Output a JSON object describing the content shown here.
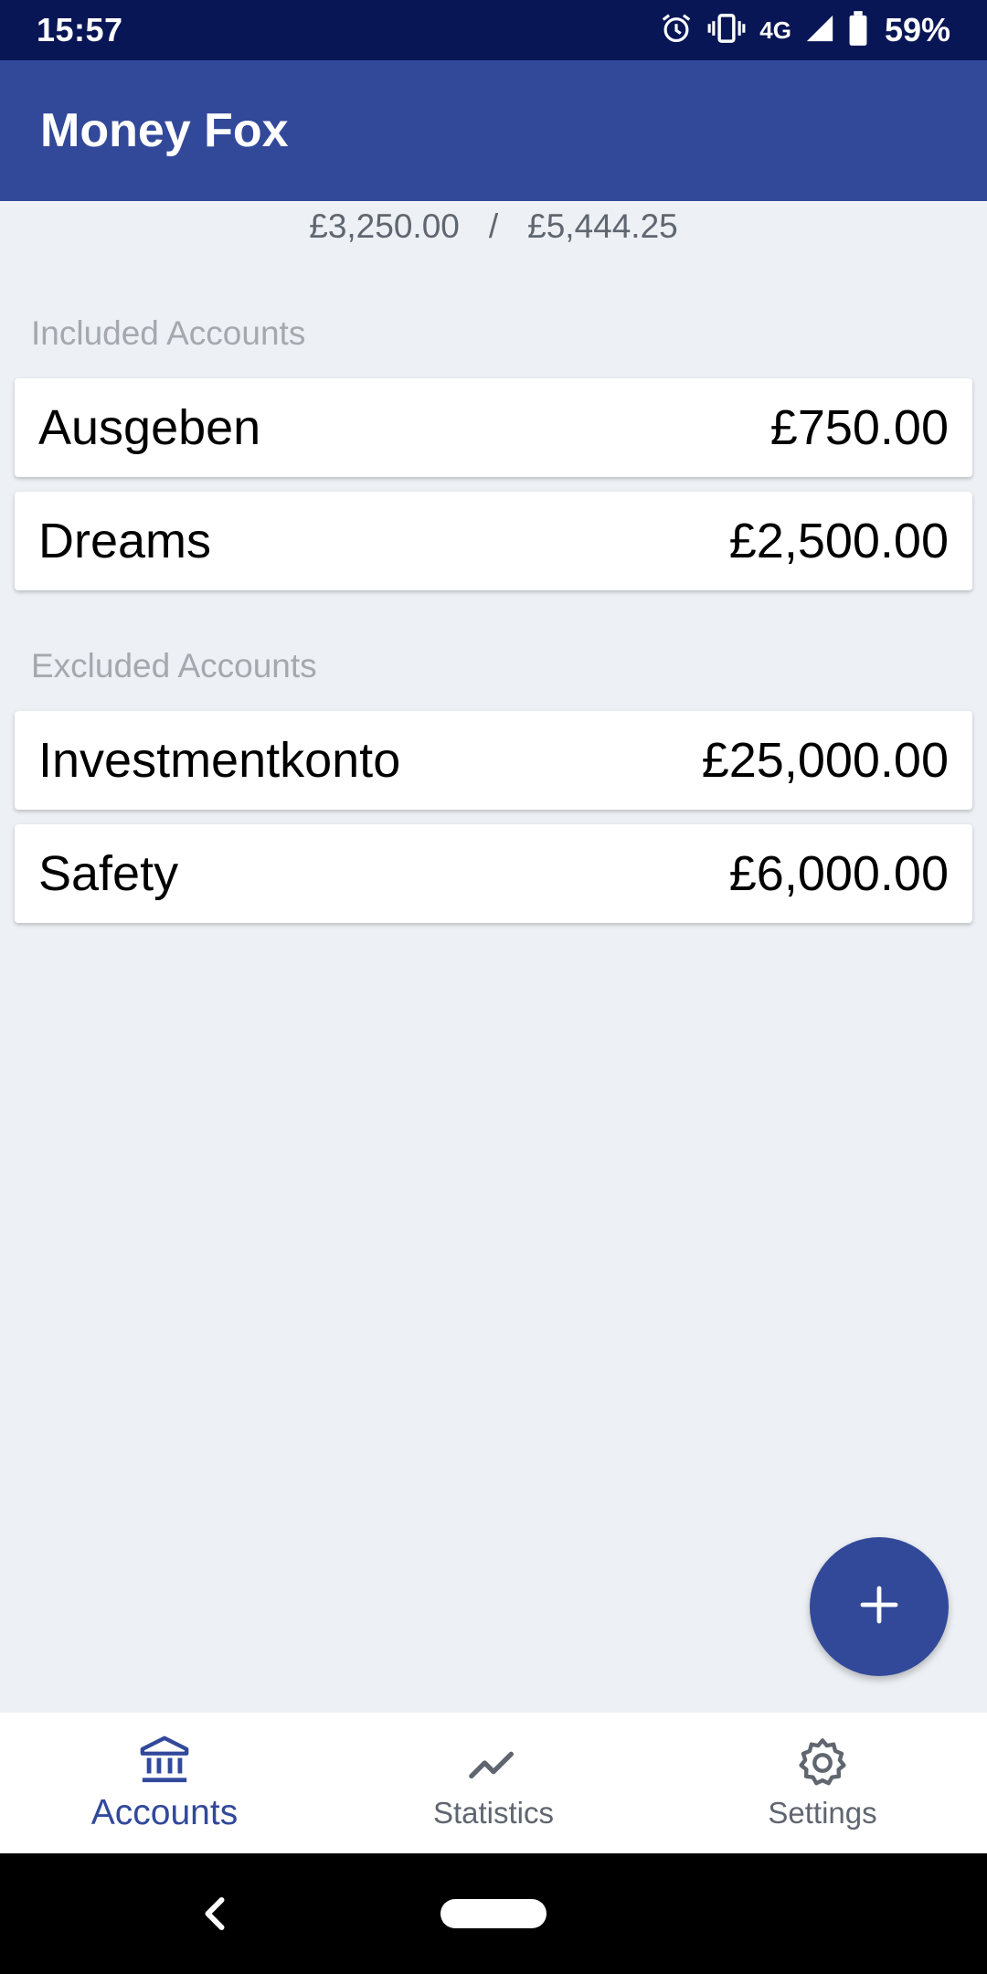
{
  "status_bar": {
    "time": "15:57",
    "network": "4G",
    "battery": "59%",
    "icons": [
      "alarm-icon",
      "vibrate-icon",
      "signal-icon",
      "battery-icon"
    ]
  },
  "app_bar": {
    "title": "Money Fox"
  },
  "summary": {
    "included_balance": "£3,250.00",
    "separator": "/",
    "total_balance": "£5,444.25"
  },
  "included": {
    "header": "Included Accounts",
    "accounts": [
      {
        "name": "Ausgeben",
        "balance": "£750.00"
      },
      {
        "name": "Dreams",
        "balance": "£2,500.00"
      }
    ]
  },
  "excluded": {
    "header": "Excluded Accounts",
    "accounts": [
      {
        "name": "Investmentkonto",
        "balance": "£25,000.00"
      },
      {
        "name": "Safety",
        "balance": "£6,000.00"
      }
    ]
  },
  "fab": {
    "icon": "add-icon"
  },
  "bottom_nav": {
    "items": [
      {
        "label": "Accounts",
        "icon": "bank-icon",
        "active": true
      },
      {
        "label": "Statistics",
        "icon": "trend-icon",
        "active": false
      },
      {
        "label": "Settings",
        "icon": "gear-icon",
        "active": false
      }
    ]
  },
  "colors": {
    "status_bar": "#081656",
    "primary": "#32499a",
    "background": "#edf0f4",
    "nav_inactive": "#5f6670"
  }
}
